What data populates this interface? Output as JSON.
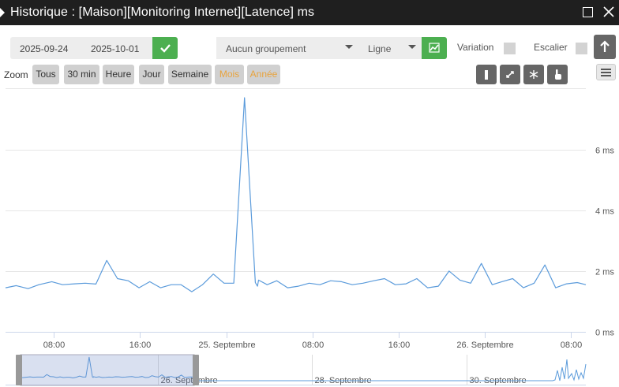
{
  "window": {
    "title": "Historique : [Maison][Monitoring Internet][Latence] ms"
  },
  "controls": {
    "date_start": "2025-09-24",
    "date_end": "2025-10-01",
    "grouping": "Aucun groupement",
    "chart_style": "Ligne",
    "variation_label": "Variation",
    "escalier_label": "Escalier",
    "variation_checked": false,
    "escalier_checked": false
  },
  "zoom": {
    "label": "Zoom",
    "buttons": [
      "Tous",
      "30 min",
      "Heure",
      "Jour",
      "Semaine",
      "Mois",
      "Année"
    ],
    "highlighted": [
      "Mois",
      "Année"
    ]
  },
  "colors": {
    "accent_green": "#4caf50",
    "series_line": "#5b9bdb",
    "highlight_text": "#e8a33d"
  },
  "chart_data": {
    "type": "line",
    "title": "",
    "xlabel": "",
    "ylabel": "",
    "unit": "ms",
    "ylim": [
      0,
      7.7
    ],
    "y_ticks": [
      {
        "value": 0,
        "label": "0 ms"
      },
      {
        "value": 2,
        "label": "2 ms"
      },
      {
        "value": 4,
        "label": "4 ms"
      },
      {
        "value": 6,
        "label": "6 ms"
      }
    ],
    "x_ticks": [
      "08:00",
      "16:00",
      "25. Septembre",
      "08:00",
      "16:00",
      "26. Septembre",
      "08:00"
    ],
    "x_tick_hours": [
      8,
      16,
      24,
      32,
      40,
      48,
      56
    ],
    "x_range_hours": [
      3.5,
      57.4
    ],
    "grid": true,
    "series": [
      {
        "x": [
          3.5,
          4.5,
          5.6,
          6.6,
          7.8,
          8.8,
          9.9,
          10.9,
          11.9,
          12.9,
          13.9,
          14.9,
          15.9,
          16.9,
          17.9,
          18.9,
          19.8,
          20.8,
          21.8,
          22.8,
          23.8,
          24.7,
          25.7,
          26.7,
          26.9,
          27.0,
          27.8,
          28.7,
          29.7,
          30.7,
          31.7,
          32.7,
          33.7,
          34.7,
          35.7,
          36.7,
          37.7,
          38.7,
          39.7,
          40.7,
          41.7,
          42.7,
          43.7,
          44.7,
          45.7,
          46.7,
          47.7,
          48.7,
          49.6,
          50.6,
          51.6,
          52.6,
          53.6,
          54.6,
          55.6,
          56.6,
          57.4
        ],
        "y": [
          1.45,
          1.52,
          1.42,
          1.55,
          1.65,
          1.55,
          1.58,
          1.6,
          1.57,
          2.35,
          1.75,
          1.68,
          1.45,
          1.65,
          1.45,
          1.55,
          1.55,
          1.32,
          1.55,
          1.9,
          1.6,
          1.6,
          7.7,
          1.62,
          1.5,
          1.7,
          1.55,
          1.68,
          1.45,
          1.5,
          1.6,
          1.55,
          1.68,
          1.65,
          1.55,
          1.6,
          1.68,
          1.75,
          1.55,
          1.58,
          1.75,
          1.45,
          1.5,
          2.0,
          1.7,
          1.6,
          2.25,
          1.55,
          1.65,
          1.75,
          1.45,
          1.6,
          2.2,
          1.45,
          1.58,
          1.62,
          1.55
        ]
      }
    ],
    "navigator": {
      "labels": [
        "26. Septembre",
        "28. Septembre",
        "30. Septembre"
      ]
    }
  }
}
